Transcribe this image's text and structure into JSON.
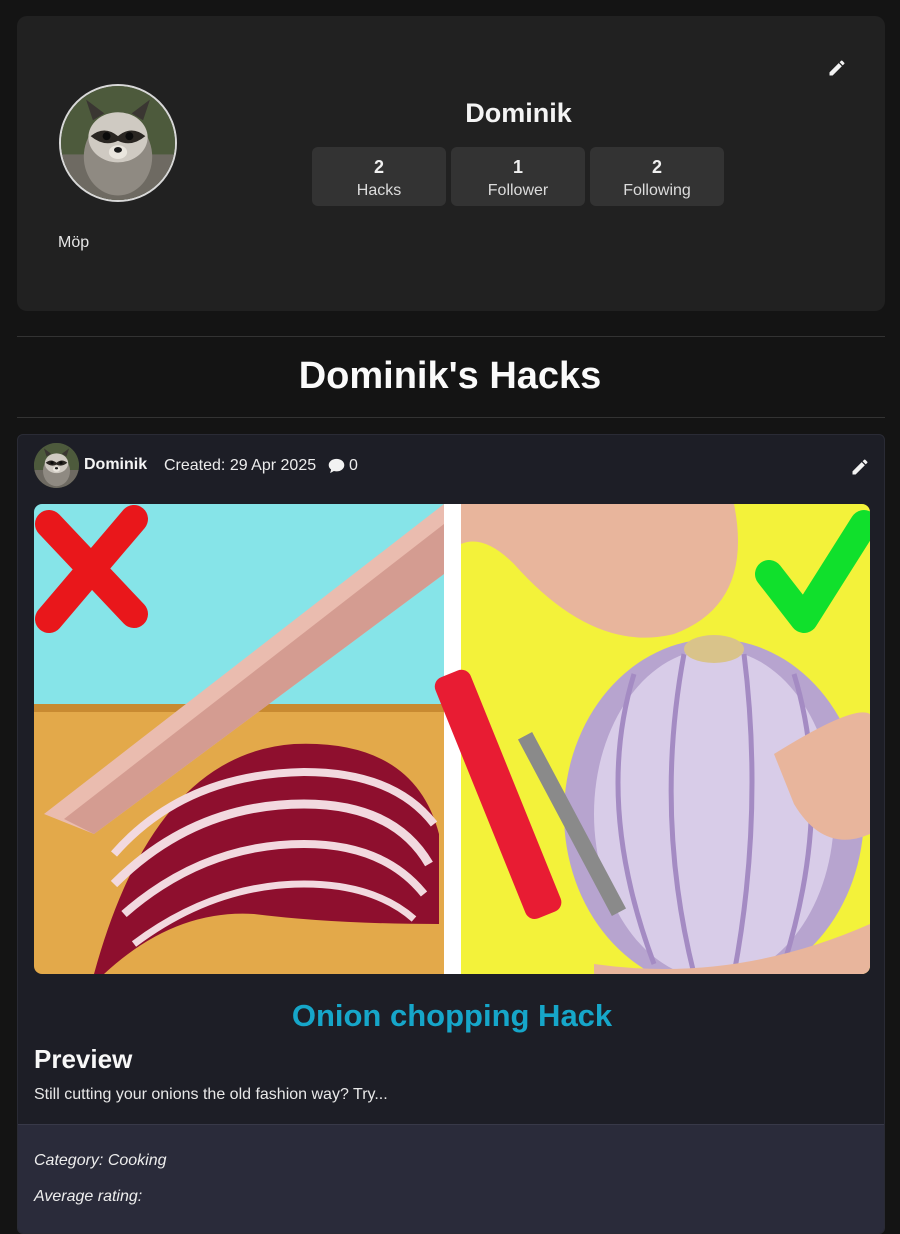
{
  "profile": {
    "name": "Dominik",
    "bio": "Möp",
    "stats": [
      {
        "value": "2",
        "label": "Hacks"
      },
      {
        "value": "1",
        "label": "Follower"
      },
      {
        "value": "2",
        "label": "Following"
      }
    ]
  },
  "section_title": "Dominik's Hacks",
  "hack": {
    "author": "Dominik",
    "created": "Created: 29 Apr 2025",
    "comment_count": "0",
    "title": "Onion chopping Hack",
    "preview_heading": "Preview",
    "preview_text": "Still cutting your onions the old fashion way? Try...",
    "category": "Category: Cooking",
    "rating_label": "Average rating:"
  },
  "colors": {
    "background": "#141414",
    "card": "#212121",
    "stat_box": "#333333",
    "hack_card": "#1d1e26",
    "meta_box": "#2a2b3a",
    "title_accent": "#16a6c9"
  },
  "icons": {
    "edit": "pencil-icon",
    "comments": "speech-bubble-icon"
  }
}
